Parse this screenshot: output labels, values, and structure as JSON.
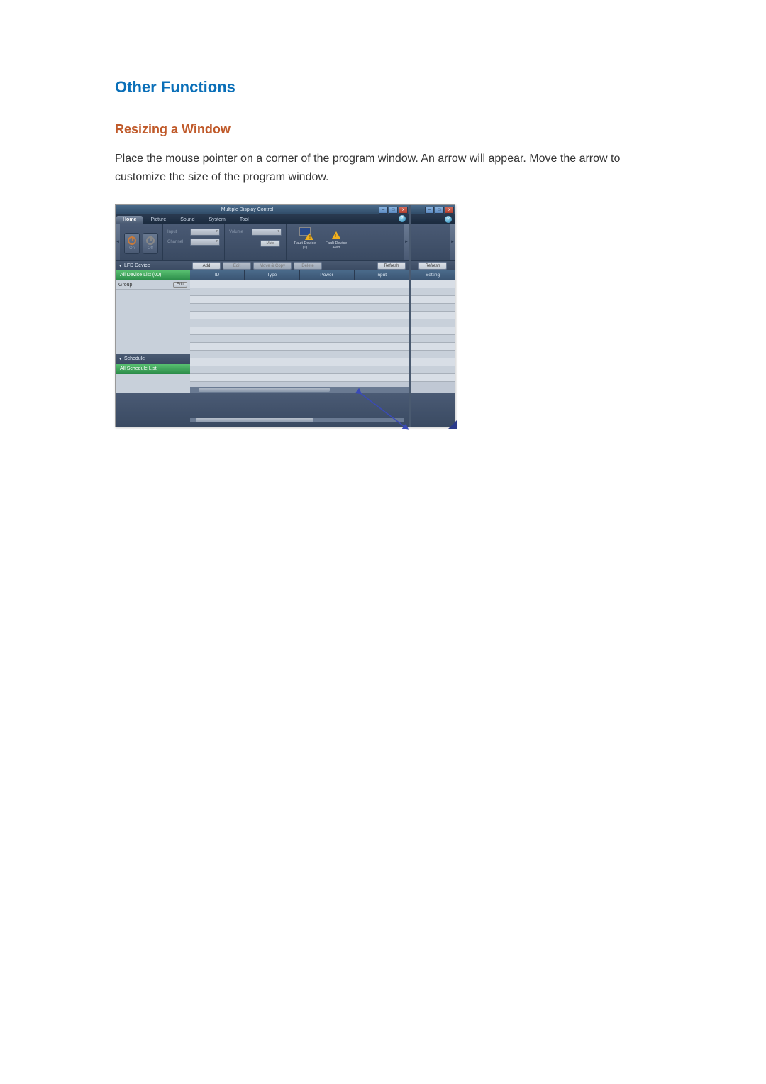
{
  "headings": {
    "main": "Other Functions",
    "sub": "Resizing a Window"
  },
  "body_text": "Place the mouse pointer on a corner of the program window. An arrow will appear. Move the arrow to customize the size of the program window.",
  "app": {
    "title": "Multiple Display Control",
    "window_controls": {
      "min": "–",
      "max": "□",
      "close": "x"
    },
    "help_label": "?",
    "menu": {
      "tabs": [
        "Home",
        "Picture",
        "Sound",
        "System",
        "Tool"
      ],
      "active_index": 0
    },
    "ribbon": {
      "power": {
        "on": "On",
        "off": "Off"
      },
      "input_label": "Input",
      "channel_label": "Channel",
      "volume_label": "Volume",
      "mute_btn": "Mute",
      "fault_device_0": "Fault Device (0)",
      "fault_alert": "Fault Device Alert"
    },
    "toolbar": {
      "add": "Add",
      "edit": "Edit",
      "move_copy": "Move & Copy",
      "delete": "Delete",
      "refresh": "Refresh"
    },
    "sidebar": {
      "lfd_header": "LFD Device",
      "all_device": "All Device List (00)",
      "group_label": "Group",
      "group_edit": "Edit",
      "schedule_header": "Schedule",
      "all_schedule": "All Schedule List"
    },
    "grid": {
      "columns": [
        "ID",
        "Type",
        "Power",
        "Input"
      ],
      "second_col": "Setting"
    },
    "second_panel": {
      "refresh": "Refresh"
    }
  }
}
